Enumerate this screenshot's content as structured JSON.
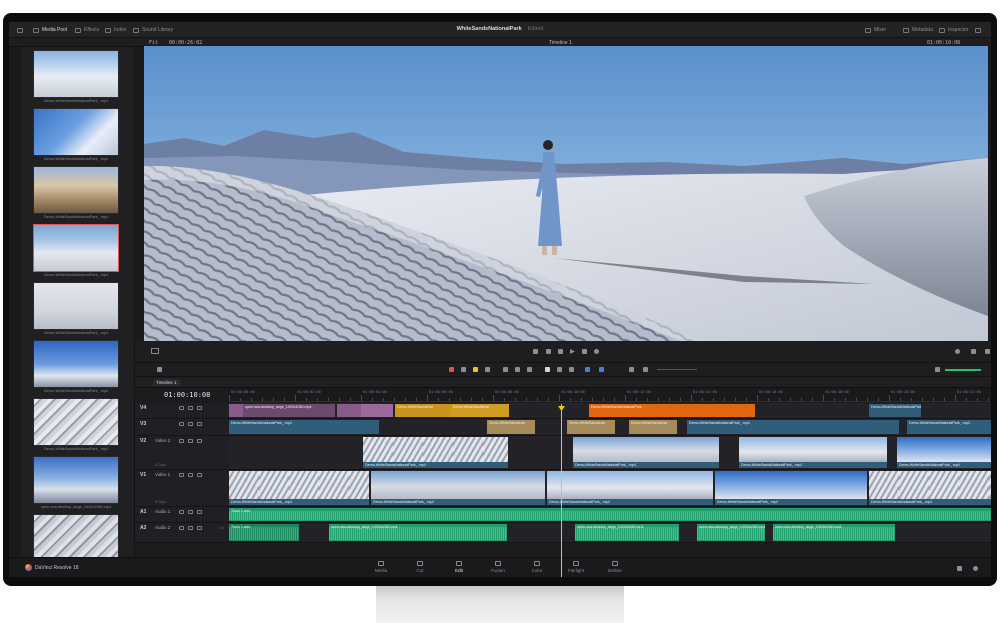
{
  "topbar": {
    "media_pool": "Media Pool",
    "effects": "Effects",
    "index": "Index",
    "sound_library": "Sound Library",
    "project_name": "WhiteSandsNationalPark",
    "project_status": "Edited",
    "mixer": "Mixer",
    "metadata": "Metadata",
    "inspector": "Inspector"
  },
  "subbar": {
    "zoom": "Fit",
    "source_tc": "00:00:26:02",
    "timeline_name": "Timeline 1",
    "record_tc": "01:00:10:08"
  },
  "media_pool": {
    "clips": [
      {
        "name": "Demo-WhiteSandsNationalPark_.mp4"
      },
      {
        "name": "Demo-WhiteSandsNationalPark_.mp4"
      },
      {
        "name": "Demo-WhiteSandsNationalPark_.mp4"
      },
      {
        "name": "Demo-WhiteSandsNationalPark_.mp4"
      },
      {
        "name": "Demo-WhiteSandsNationalPark_.mp4"
      },
      {
        "name": "Demo-WhiteSandsNationalPark_.mp4"
      },
      {
        "name": "Demo-WhiteSandsNationalPark_.mp4"
      },
      {
        "name": "open-sea-desktop_large_1920x1080.mp4"
      },
      {
        "name": ""
      }
    ]
  },
  "timeline": {
    "tab": "Timeline 1",
    "timecode": "01:00:10:08",
    "ruler": [
      "01:00:00:00",
      "01:00:02:00",
      "01:00:04:00",
      "01:00:06:00",
      "01:00:08:00",
      "01:00:10:00",
      "01:00:12:00",
      "01:00:14:00",
      "01:00:16:00",
      "01:00:18:00",
      "01:00:20:00",
      "01:00:22:00"
    ],
    "tracks": [
      {
        "id": "V4",
        "name": "",
        "sub": ""
      },
      {
        "id": "V3",
        "name": "",
        "sub": ""
      },
      {
        "id": "V2",
        "name": "Video 2",
        "sub": "8 Clips"
      },
      {
        "id": "V1",
        "name": "Video 1",
        "sub": "8 Clips"
      },
      {
        "id": "A1",
        "name": "Audio 1",
        "sub": "",
        "level": ""
      },
      {
        "id": "A2",
        "name": "Audio 2",
        "sub": "",
        "level": "2.0"
      }
    ],
    "clip_labels": {
      "open_sea": "open-sea-desktop_large_1920x1080.mp4",
      "demo": "Demo-WhiteSandsNationalPark_.mp4",
      "demo_short": "Demo-WhiteSandsNat",
      "demo_pk": "Demo-WhiteSandsNationalPark",
      "track1": "Track 1.wav",
      "open_sea_short": "open-sea-desktop_large_1920x1080.mp4"
    }
  },
  "pages": [
    {
      "label": "Media"
    },
    {
      "label": "Cut"
    },
    {
      "label": "Edit"
    },
    {
      "label": "Fusion"
    },
    {
      "label": "Color"
    },
    {
      "label": "Fairlight"
    },
    {
      "label": "Deliver"
    }
  ],
  "brand": "DaVinci Resolve 18",
  "colors": {
    "accent": "#e0524d",
    "playhead": "#f0c419",
    "clip_blue": "#2f5d7a",
    "clip_gold": "#c9941c",
    "clip_orange": "#e2680f",
    "clip_purple": "#8a5a8a",
    "clip_tan": "#a58a5a",
    "audio_green": "#1e9e6a"
  }
}
